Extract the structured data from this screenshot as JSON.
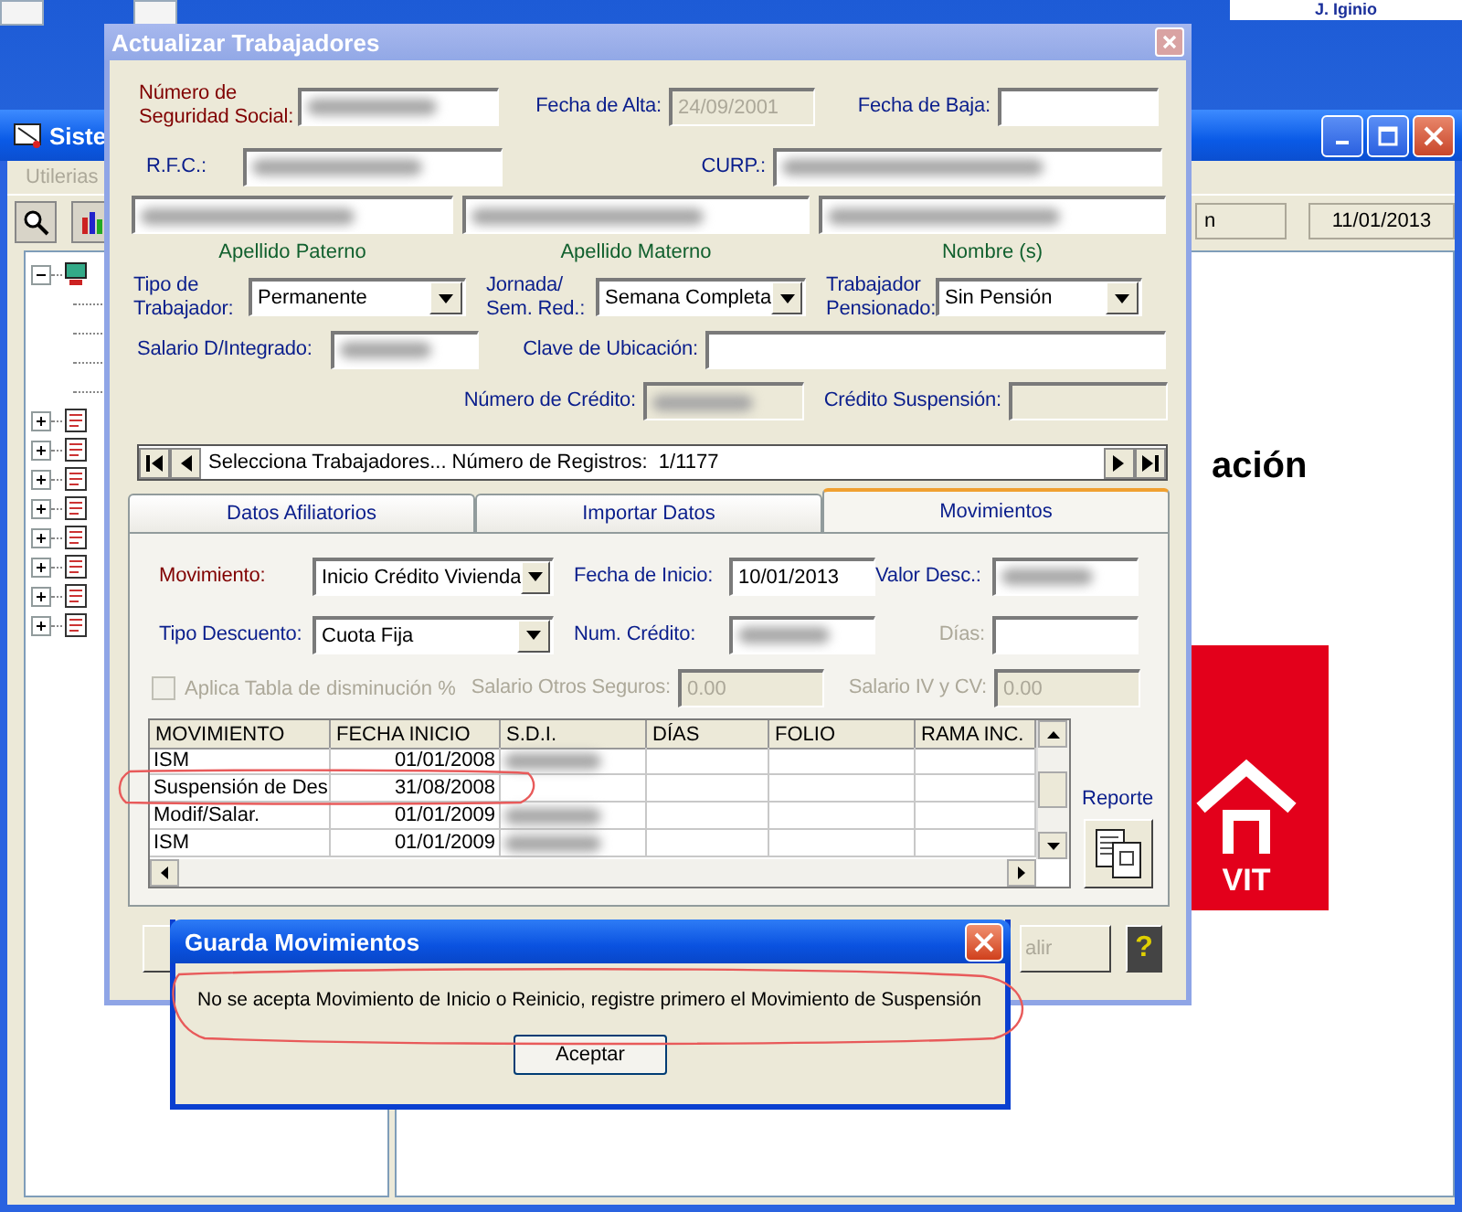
{
  "desktop": {
    "corner_label": "J. Iginio"
  },
  "main_window": {
    "title": "Siste",
    "menu": [
      {
        "label": "Utilerias",
        "disabled": true
      }
    ],
    "status": [
      "n",
      "11/01/2013"
    ],
    "tree": [
      {
        "expanded": true,
        "children": [
          {
            "kind": "leaf"
          },
          {
            "kind": "leaf"
          },
          {
            "kind": "leaf"
          },
          {
            "kind": "leaf"
          }
        ]
      },
      {
        "expanded": false
      },
      {
        "expanded": false
      },
      {
        "expanded": false
      },
      {
        "expanded": false
      },
      {
        "expanded": false
      },
      {
        "expanded": false
      },
      {
        "expanded": false
      },
      {
        "expanded": false
      }
    ],
    "heading": "ación",
    "logo_text": "VIT"
  },
  "update_window": {
    "title": "Actualizar Trabajadores",
    "form_rows": [
      [
        {
          "kind": "label",
          "text": "Número de\nSeguridad Social:",
          "required": true
        },
        {
          "kind": "field",
          "blurred": true,
          "disabled": false
        },
        {
          "kind": "label",
          "text": "Fecha de Alta:",
          "required": false
        },
        {
          "kind": "field",
          "value": "24/09/2001",
          "blurred": false,
          "disabled": true
        },
        {
          "kind": "label",
          "text": "Fecha de Baja:",
          "required": false
        },
        {
          "kind": "field",
          "blurred": false,
          "disabled": false
        }
      ],
      [
        {
          "kind": "label",
          "text": "R.F.C.:",
          "required": false
        },
        {
          "kind": "field",
          "blurred": true,
          "disabled": false
        },
        {
          "kind": "label",
          "text": "CURP.:",
          "required": false
        },
        {
          "kind": "field",
          "blurred": true,
          "disabled": false
        }
      ],
      [
        {
          "kind": "field",
          "blurred": true,
          "disabled": false
        },
        {
          "kind": "field",
          "blurred": true,
          "disabled": false
        },
        {
          "kind": "field",
          "blurred": true,
          "disabled": false
        }
      ],
      [
        {
          "kind": "caption",
          "text": "Apellido Paterno"
        },
        {
          "kind": "caption",
          "text": "Apellido Materno"
        },
        {
          "kind": "caption",
          "text": "Nombre (s)"
        }
      ],
      [
        {
          "kind": "label",
          "text": "Tipo de\nTrabajador:",
          "required": false
        },
        {
          "kind": "select",
          "value": "Permanente"
        },
        {
          "kind": "label",
          "text": "Jornada/\nSem. Red.:",
          "required": false
        },
        {
          "kind": "select",
          "value": "Semana Completa"
        },
        {
          "kind": "label",
          "text": "Trabajador\nPensionado:",
          "required": false
        },
        {
          "kind": "select",
          "value": "Sin Pensión"
        }
      ],
      [
        {
          "kind": "label",
          "text": "Salario D/Integrado:",
          "required": false
        },
        {
          "kind": "field",
          "blurred": true,
          "disabled": false
        },
        {
          "kind": "label",
          "text": "Clave de Ubicación:",
          "required": false
        },
        {
          "kind": "field",
          "blurred": false,
          "disabled": false
        }
      ],
      [
        {
          "kind": "label",
          "text": "Número de Crédito:",
          "required": false
        },
        {
          "kind": "field",
          "blurred": true,
          "disabled": true
        },
        {
          "kind": "label",
          "text": "Crédito Suspensión:",
          "required": false
        },
        {
          "kind": "field",
          "blurred": false,
          "disabled": true
        }
      ]
    ],
    "navigator": {
      "text": "Selecciona Trabajadores... Número de Registros:  1/1177"
    },
    "tabs": [
      {
        "label": "Datos Afiliatorios",
        "selected": false
      },
      {
        "label": "Importar Datos",
        "selected": false
      },
      {
        "label": "Movimientos",
        "selected": true
      }
    ],
    "tab_rows": [
      [
        {
          "kind": "label",
          "text": "Movimiento:",
          "required": true,
          "disabled": false
        },
        {
          "kind": "select",
          "value": "Inicio Crédito Vivienda"
        },
        {
          "kind": "label",
          "text": "Fecha de Inicio:",
          "required": false,
          "disabled": false
        },
        {
          "kind": "field",
          "value": "10/01/2013",
          "blurred": false,
          "disabled": false
        },
        {
          "kind": "label",
          "text": "Valor Desc.:",
          "required": false,
          "disabled": false
        },
        {
          "kind": "field",
          "blurred": true,
          "disabled": false
        }
      ],
      [
        {
          "kind": "label",
          "text": "Tipo Descuento:",
          "required": false,
          "disabled": false
        },
        {
          "kind": "select",
          "value": "Cuota Fija"
        },
        {
          "kind": "label",
          "text": "Num. Crédito:",
          "required": false,
          "disabled": false
        },
        {
          "kind": "field",
          "blurred": true,
          "disabled": false
        },
        {
          "kind": "label",
          "text": "Días:",
          "required": false,
          "disabled": true
        },
        {
          "kind": "field",
          "blurred": false,
          "disabled": false
        }
      ],
      [
        {
          "kind": "checkbox",
          "label": "Aplica Tabla de disminución %",
          "checked": false,
          "disabled": true
        },
        {
          "kind": "label",
          "text": "Salario Otros Seguros:",
          "required": false,
          "disabled": true
        },
        {
          "kind": "field",
          "value": "0.00",
          "blurred": false,
          "disabled": true
        },
        {
          "kind": "label",
          "text": "Salario IV y CV:",
          "required": false,
          "disabled": true
        },
        {
          "kind": "field",
          "value": "0.00",
          "blurred": false,
          "disabled": true
        }
      ]
    ],
    "table": {
      "columns": [
        "MOVIMIENTO",
        "FECHA INICIO",
        "S.D.I.",
        "DÍAS",
        "FOLIO",
        "RAMA INC."
      ],
      "rows": [
        {
          "movimiento": "ISM",
          "fecha_inicio": "01/01/2008",
          "sdi_blurred": true
        },
        {
          "movimiento": "Suspensión de Des",
          "fecha_inicio": "31/08/2008",
          "sdi_blurred": false
        },
        {
          "movimiento": "Modif/Salar.",
          "fecha_inicio": "01/01/2009",
          "sdi_blurred": true
        },
        {
          "movimiento": "ISM",
          "fecha_inicio": "01/01/2009",
          "sdi_blurred": true
        }
      ]
    },
    "report_label": "Reporte",
    "exit_button": {
      "label": "alir",
      "disabled": true
    },
    "help_button": "?"
  },
  "dialog": {
    "title": "Guarda Movimientos",
    "message": "No se acepta Movimiento de Inicio o Reinicio, registre primero el Movimiento de Suspensión",
    "buttons": [
      "Aceptar"
    ]
  }
}
